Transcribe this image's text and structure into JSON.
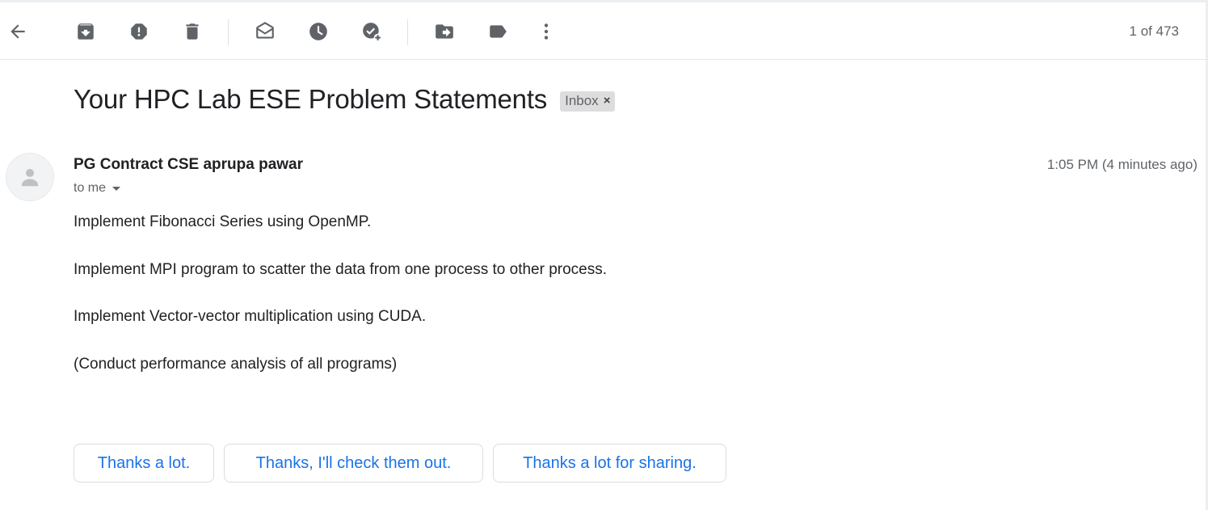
{
  "toolbar": {
    "buttons": [
      {
        "icon": "back-arrow-icon"
      },
      {
        "icon": "archive-icon"
      },
      {
        "icon": "report-spam-icon"
      },
      {
        "icon": "delete-icon"
      },
      {
        "icon": "mark-unread-icon"
      },
      {
        "icon": "snooze-icon"
      },
      {
        "icon": "add-to-tasks-icon"
      },
      {
        "icon": "move-to-icon"
      },
      {
        "icon": "label-icon"
      },
      {
        "icon": "more-options-icon"
      }
    ],
    "counter": "1 of 473"
  },
  "email": {
    "subject": "Your HPC Lab ESE Problem Statements",
    "label": "Inbox",
    "label_close": "×",
    "sender": "PG Contract CSE aprupa pawar",
    "time": "1:05 PM (4 minutes ago)",
    "recipient": "to me",
    "body": [
      "Implement Fibonacci Series using OpenMP.",
      "Implement MPI program to scatter the data from one process to other process.",
      "Implement Vector-vector multiplication using CUDA.",
      "(Conduct performance analysis of all programs)"
    ]
  },
  "smart_replies": [
    "Thanks a lot.",
    "Thanks, I'll check them out.",
    "Thanks a lot for sharing."
  ],
  "colors": {
    "icon": "#5f6368",
    "link_blue": "#1a73e8",
    "chip_bg": "#dddddd"
  }
}
